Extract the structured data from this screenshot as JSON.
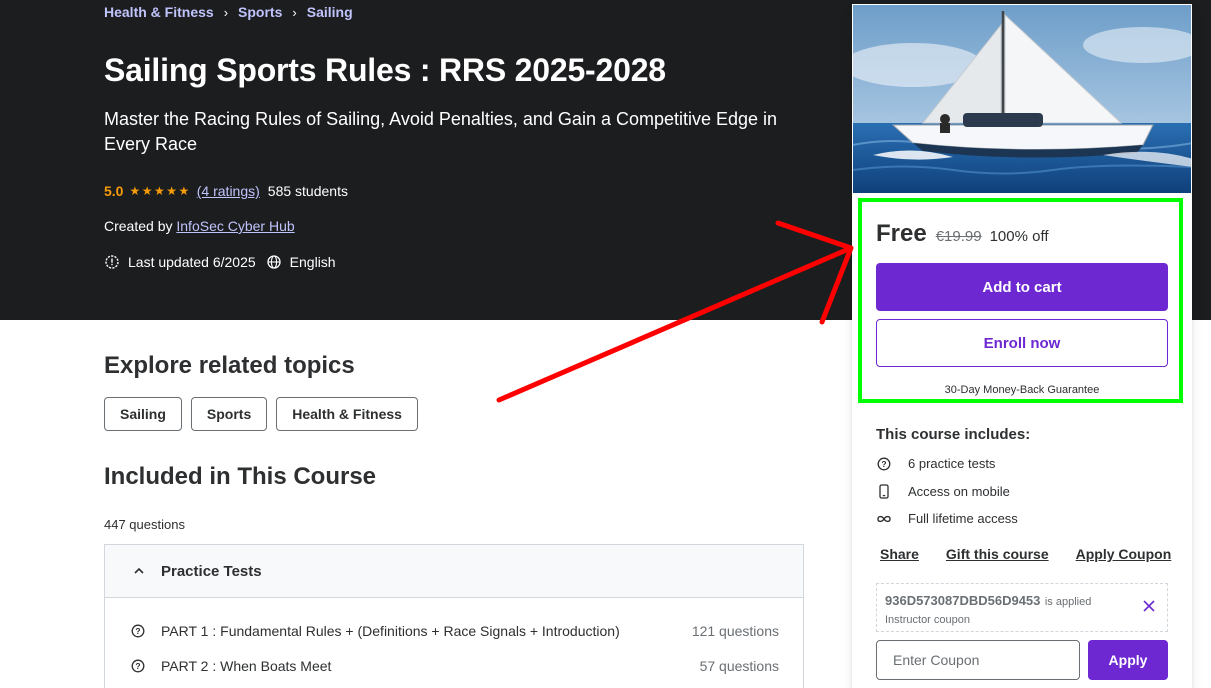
{
  "breadcrumb": [
    "Health & Fitness",
    "Sports",
    "Sailing"
  ],
  "course": {
    "title": "Sailing Sports Rules : RRS 2025-2028",
    "subtitle": "Master the Racing Rules of Sailing, Avoid Penalties, and Gain a Competitive Edge in Every Race",
    "rating": "5.0",
    "stars": "★★★★★",
    "ratings_count": "(4 ratings)",
    "students": "585 students",
    "created_by_label": "Created by",
    "instructor": "InfoSec Cyber Hub",
    "last_updated": "Last updated 6/2025",
    "language": "English"
  },
  "related": {
    "heading": "Explore related topics",
    "topics": [
      "Sailing",
      "Sports",
      "Health & Fitness"
    ]
  },
  "included": {
    "heading": "Included in This Course",
    "question_count": "447 questions",
    "section_title": "Practice Tests",
    "tests": [
      {
        "title": "PART 1 : Fundamental Rules + (Definitions + Race Signals + Introduction)",
        "count": "121 questions"
      },
      {
        "title": "PART 2 : When Boats Meet",
        "count": "57 questions"
      }
    ]
  },
  "sidebar": {
    "price": "Free",
    "original_price": "€19.99",
    "discount": "100% off",
    "add_to_cart": "Add to cart",
    "enroll_now": "Enroll now",
    "guarantee": "30-Day Money-Back Guarantee",
    "includes_title": "This course includes:",
    "includes": [
      {
        "icon": "question-circle-icon",
        "label": "6 practice tests"
      },
      {
        "icon": "mobile-icon",
        "label": "Access on mobile"
      },
      {
        "icon": "infinity-icon",
        "label": "Full lifetime access"
      }
    ],
    "links": [
      "Share",
      "Gift this course",
      "Apply Coupon"
    ],
    "coupon": {
      "code": "936D573087DBD56D9453",
      "applied_text": "is applied",
      "type": "Instructor coupon",
      "input_placeholder": "Enter Coupon",
      "apply_label": "Apply"
    }
  },
  "colors": {
    "hero_bg": "#1c1d1f",
    "accent_purple": "#6d28d2",
    "link_lavender": "#c0c4fc",
    "star_orange": "#f69c08",
    "annotation_red": "#ff0000",
    "annotation_green": "#00ff00"
  }
}
